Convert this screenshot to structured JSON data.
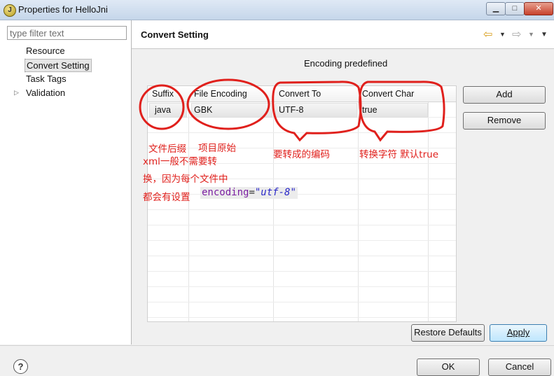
{
  "window": {
    "title": "Properties for HelloJni",
    "app_icon_glyph": "J"
  },
  "left_pane": {
    "filter_placeholder": "type filter text",
    "items": [
      {
        "label": "Resource"
      },
      {
        "label": "Convert Setting",
        "selected": true
      },
      {
        "label": "Task Tags"
      },
      {
        "label": "Validation",
        "expandable": true
      }
    ]
  },
  "page": {
    "title": "Convert Setting",
    "encoding_label": "Encoding predefined"
  },
  "table": {
    "columns": [
      "Suffix",
      "File Encoding",
      "Convert To",
      "Convert Char"
    ],
    "rows": [
      [
        "java",
        "GBK",
        "UTF-8",
        "true"
      ]
    ]
  },
  "buttons": {
    "add": "Add",
    "remove": "Remove",
    "restore_defaults": "Restore Defaults",
    "apply": "Apply",
    "ok": "OK",
    "cancel": "Cancel",
    "help": "?"
  },
  "annotations": {
    "suffix_note": "文件后缀",
    "original_note": "项目原始",
    "xml_note": "xml一般不需要转",
    "change_note": "换，因为每个文件中",
    "everyfile_note": "都会有设置",
    "code_keyword": "encoding",
    "code_equals": "=",
    "code_value": "\"utf-8\"",
    "target_note": "要转成的编码",
    "convchar_note": "转换字符 默认true",
    "color": "#e0201c"
  }
}
